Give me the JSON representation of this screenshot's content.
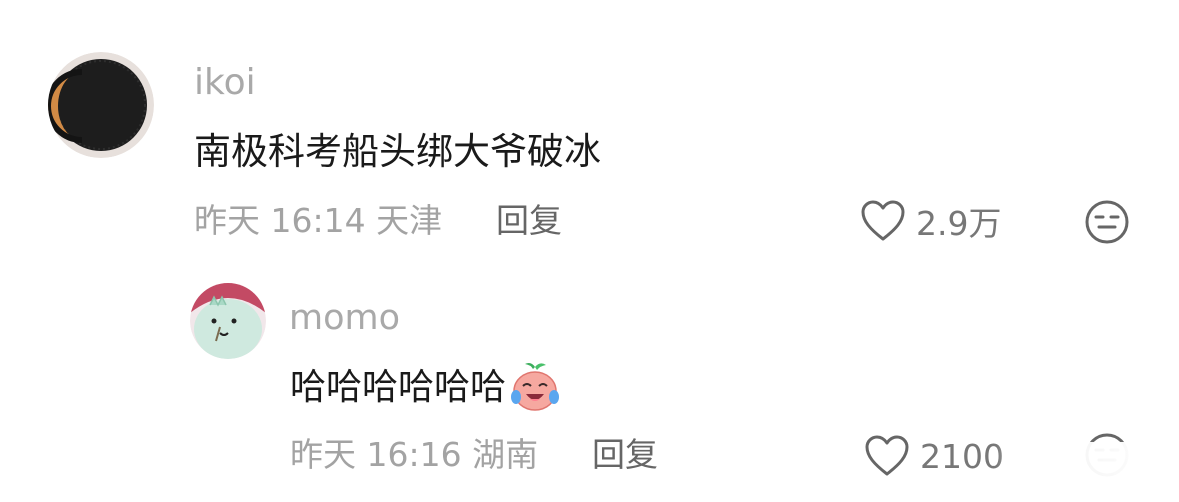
{
  "comment": {
    "username": "ikoi",
    "text": "南极科考船头绑大爷破冰",
    "meta": "昨天 16:14 天津",
    "reply_label": "回复",
    "like_count": "2.9万",
    "avatar_icon": "moon-avatar",
    "dislike_icon": "unamused-face-icon"
  },
  "reply": {
    "username": "momo",
    "text": "哈哈哈哈哈哈",
    "emoji_icon": "laughing-tears-emoji",
    "meta": "昨天 16:16 湖南",
    "reply_label": "回复",
    "like_count": "2100",
    "avatar_icon": "green-dino-avatar",
    "dislike_icon": "dislike-face-icon"
  }
}
